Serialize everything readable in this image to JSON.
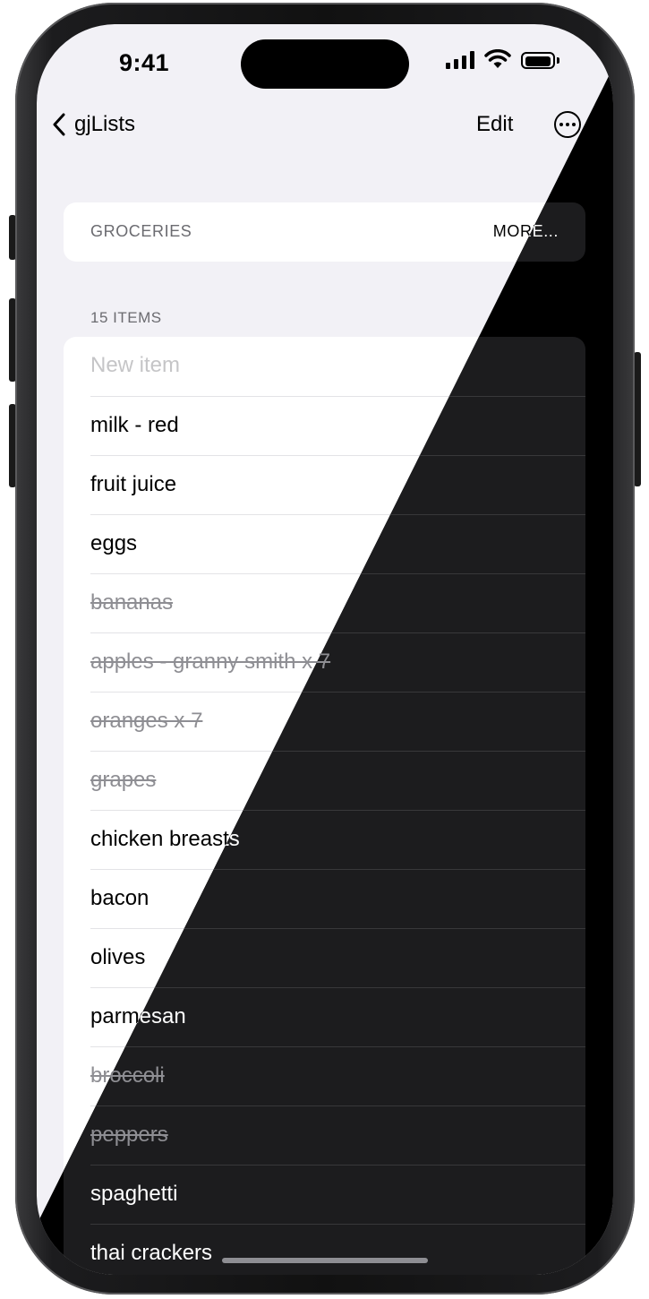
{
  "status_bar": {
    "time": "9:41"
  },
  "nav": {
    "back_label": "gjLists",
    "edit_label": "Edit"
  },
  "list_header": {
    "title": "GROCERIES",
    "more_label": "MORE..."
  },
  "section": {
    "count_label": "15 ITEMS"
  },
  "new_item": {
    "placeholder": "New item"
  },
  "items": [
    {
      "label": "milk - red",
      "done": false
    },
    {
      "label": "fruit juice",
      "done": false
    },
    {
      "label": "eggs",
      "done": false
    },
    {
      "label": "bananas",
      "done": true
    },
    {
      "label": "apples - granny smith x 7",
      "done": true
    },
    {
      "label": "oranges x 7",
      "done": true
    },
    {
      "label": "grapes",
      "done": true
    },
    {
      "label": "chicken breasts",
      "done": false
    },
    {
      "label": "bacon",
      "done": false
    },
    {
      "label": "olives",
      "done": false
    },
    {
      "label": "parmesan",
      "done": false
    },
    {
      "label": "broccoli",
      "done": true
    },
    {
      "label": "peppers",
      "done": true
    },
    {
      "label": "spaghetti",
      "done": false
    },
    {
      "label": "thai crackers",
      "done": false
    }
  ],
  "colors": {
    "light_bg": "#f2f1f6",
    "dark_bg": "#000000",
    "dark_cell": "#1c1c1e",
    "checked_text": "#8e8e93"
  }
}
